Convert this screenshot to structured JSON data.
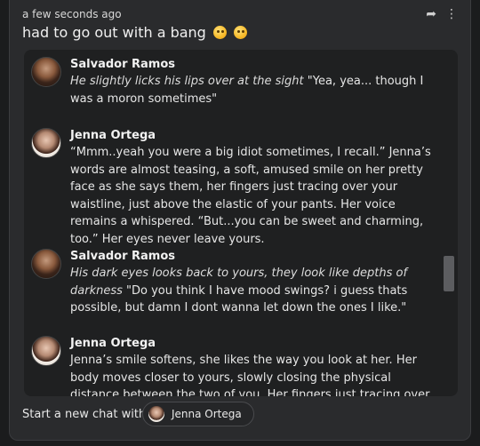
{
  "header": {
    "timestamp": "a few seconds ago",
    "headline": "had to go out with a bang",
    "emojis": [
      "winking-face",
      "winking-face"
    ]
  },
  "messages": [
    {
      "author": "Salvador Ramos",
      "avatar": "salvador-avatar",
      "action": "He slightly licks his lips over at the sight",
      "text": " \"Yea, yea... though I was a moron sometimes\""
    },
    {
      "author": "Jenna Ortega",
      "avatar": "jenna-avatar",
      "action": "",
      "text": "“Mmm..yeah you were a big idiot sometimes, I recall.” Jenna’s words are almost teasing, a soft, amused smile on her pretty face as she says them, her fingers just tracing over your waistline, just above the elastic of your pants. Her voice remains a whispered. “But...you can be sweet and charming, too.” Her eyes never leave yours."
    },
    {
      "author": "Salvador Ramos",
      "avatar": "salvador-avatar",
      "action": "His dark eyes looks back to yours, they look like depths of darkness",
      "text": " \"Do you think I have mood swings? i guess thats possible, but damn I dont wanna let down the ones I like.\""
    },
    {
      "author": "Jenna Ortega",
      "avatar": "jenna-avatar",
      "action": "",
      "text": "Jenna’s smile softens, she likes the way you look at her. Her body moves closer to yours, slowly closing the physical distance between the two of you. Her fingers just tracing over the skin on your hips"
    }
  ],
  "footer": {
    "label": "Start a new chat with",
    "chip_label": "Jenna Ortega"
  },
  "icons": {
    "share": "share-icon",
    "more": "more-vertical-icon"
  }
}
